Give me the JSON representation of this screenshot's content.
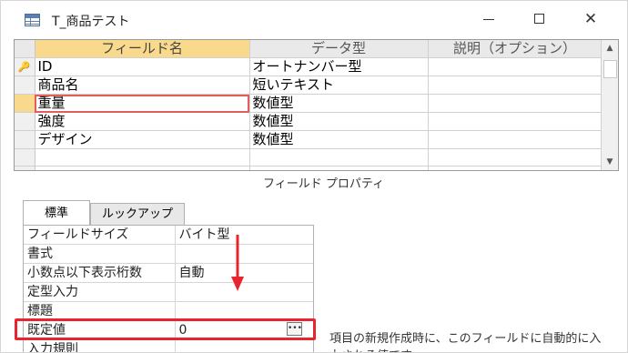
{
  "window": {
    "title": "T_商品テスト",
    "minimize_icon": "minimize-icon",
    "maximize_icon": "maximize-icon",
    "close_glyph": "✕"
  },
  "grid": {
    "headers": [
      "フィールド名",
      "データ型",
      "説明（オプション）"
    ],
    "rows": [
      {
        "key": true,
        "field": "ID",
        "type": "オートナンバー型",
        "desc": ""
      },
      {
        "key": false,
        "field": "商品名",
        "type": "短いテキスト",
        "desc": ""
      },
      {
        "key": false,
        "field": "重量",
        "type": "数値型",
        "desc": "",
        "current": true
      },
      {
        "key": false,
        "field": "強度",
        "type": "数値型",
        "desc": ""
      },
      {
        "key": false,
        "field": "デザイン",
        "type": "数値型",
        "desc": ""
      },
      {
        "key": false,
        "field": "",
        "type": "",
        "desc": ""
      },
      {
        "key": false,
        "field": "",
        "type": "",
        "desc": ""
      }
    ]
  },
  "properties": {
    "section_title": "フィールド プロパティ",
    "tabs": [
      "標準",
      "ルックアップ"
    ],
    "rows": [
      {
        "label": "フィールドサイズ",
        "value": "バイト型"
      },
      {
        "label": "書式",
        "value": ""
      },
      {
        "label": "小数点以下表示桁数",
        "value": "自動"
      },
      {
        "label": "定型入力",
        "value": ""
      },
      {
        "label": "標題",
        "value": ""
      },
      {
        "label": "既定値",
        "value": "0",
        "builder": true
      },
      {
        "label": "入力規則",
        "value": ""
      }
    ],
    "help_text": "項目の新規作成時に、このフィールドに自動的に入力される値です。"
  },
  "colors": {
    "highlight_box": "#e8242f",
    "selected_header": "#f9d98b"
  }
}
